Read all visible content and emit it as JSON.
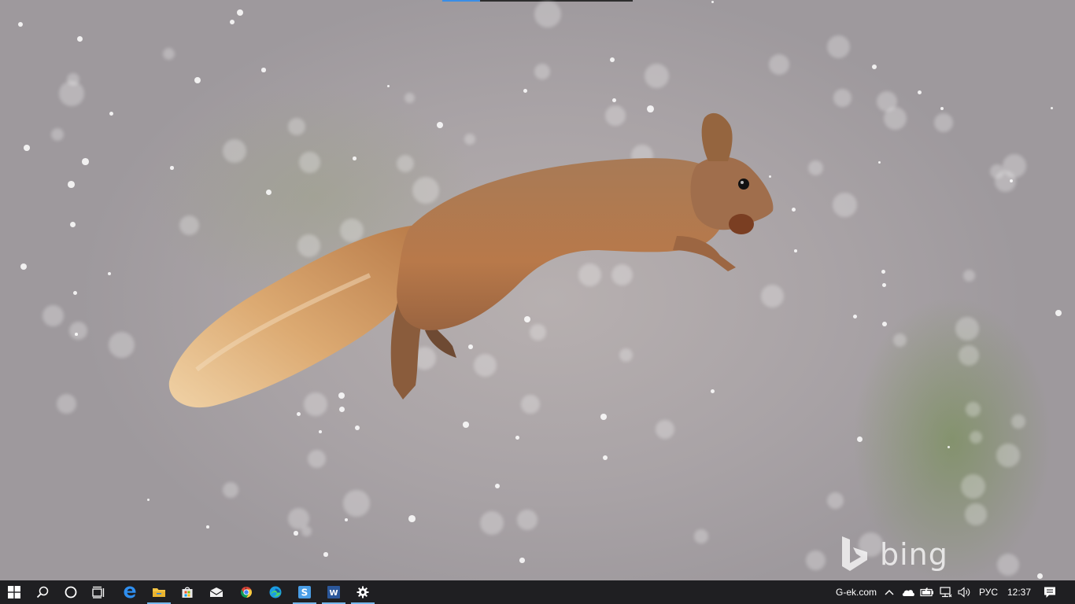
{
  "desktop": {
    "watermark": "bing"
  },
  "taskbar": {
    "pinned": [
      {
        "name": "start-button",
        "icon": "windows-icon",
        "active": false
      },
      {
        "name": "search-button",
        "icon": "search-icon",
        "active": false
      },
      {
        "name": "cortana-button",
        "icon": "cortana-ring-icon",
        "active": false
      },
      {
        "name": "task-view-button",
        "icon": "task-view-icon",
        "active": false
      },
      {
        "name": "edge-legacy-button",
        "icon": "edge-legacy-icon",
        "active": false
      },
      {
        "name": "file-explorer-button",
        "icon": "folder-icon",
        "active": true
      },
      {
        "name": "store-button",
        "icon": "store-bag-icon",
        "active": false
      },
      {
        "name": "mail-button",
        "icon": "mail-icon",
        "active": false
      },
      {
        "name": "chrome-button",
        "icon": "chrome-icon",
        "active": false
      },
      {
        "name": "edge-button",
        "icon": "edge-icon",
        "active": false
      },
      {
        "name": "app-s-button",
        "icon": "app-s-icon",
        "active": true
      },
      {
        "name": "word-button",
        "icon": "word-icon",
        "active": true
      },
      {
        "name": "settings-button",
        "icon": "gear-icon",
        "active": true
      }
    ],
    "tray": {
      "site_label": "G-ek.com",
      "language": "РУС",
      "time": "12:37"
    }
  },
  "colors": {
    "taskbar_bg": "#1f1f22",
    "active_underline": "#76b9ed",
    "word_blue": "#2b579a",
    "squirrel_fur": "#b8794a"
  }
}
